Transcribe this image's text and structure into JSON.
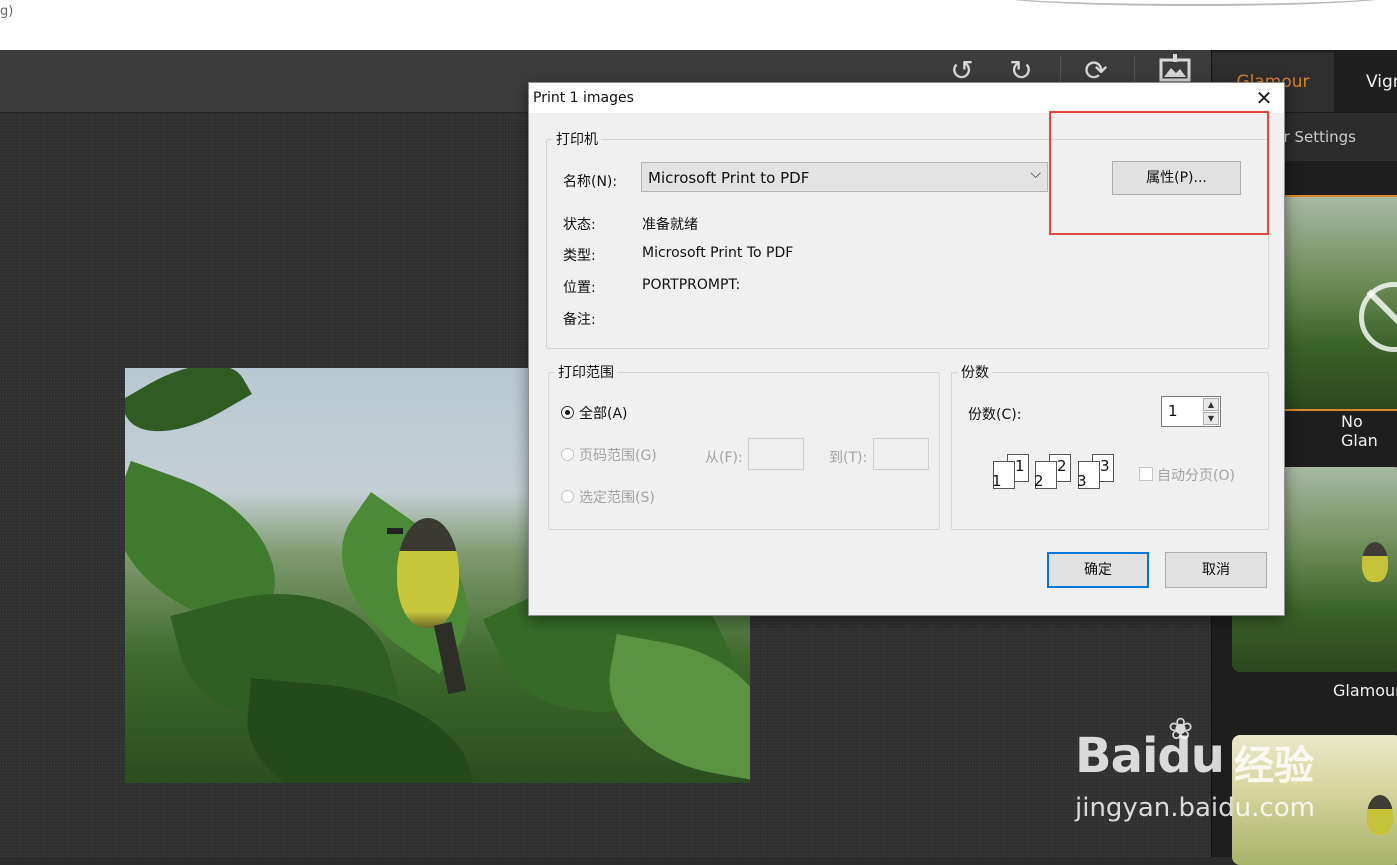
{
  "browser": {
    "url_fragment": "g)"
  },
  "toolbar": {
    "icons": [
      "rotate-left-icon",
      "rotate-right-icon",
      "sync-icon",
      "export-image-icon"
    ]
  },
  "sidebar": {
    "tabs": [
      {
        "label": "Glamour",
        "active": true
      },
      {
        "label": "Vign",
        "active": false
      }
    ],
    "settings_label": "ur Settings",
    "presets": [
      {
        "label": "No Glan"
      },
      {
        "label": "Glamour"
      }
    ],
    "accent_color": "#d9822b"
  },
  "dialog": {
    "title": "Print 1 images",
    "printer": {
      "section": "打印机",
      "name_label": "名称(N):",
      "name_value": "Microsoft Print to PDF",
      "properties_button": "属性(P)...",
      "status_label": "状态:",
      "status_value": "准备就绪",
      "type_label": "类型:",
      "type_value": "Microsoft Print To PDF",
      "location_label": "位置:",
      "location_value": "PORTPROMPT:",
      "comment_label": "备注:",
      "comment_value": ""
    },
    "range": {
      "section": "打印范围",
      "all": "全部(A)",
      "pages": "页码范围(G)",
      "from": "从(F):",
      "to": "到(T):",
      "selection": "选定范围(S)",
      "selected": "all"
    },
    "copies": {
      "section": "份数",
      "count_label": "份数(C):",
      "count_value": "1",
      "collate_label": "自动分页(O)",
      "collate_checked": false,
      "page_numbers": [
        "1",
        "1",
        "2",
        "2",
        "3",
        "3"
      ]
    },
    "ok_button": "确定",
    "cancel_button": "取消"
  },
  "watermark": {
    "logo": "Baidu",
    "cn": "经验",
    "url": "jingyan.baidu.com"
  },
  "highlight_color": "#e54545"
}
